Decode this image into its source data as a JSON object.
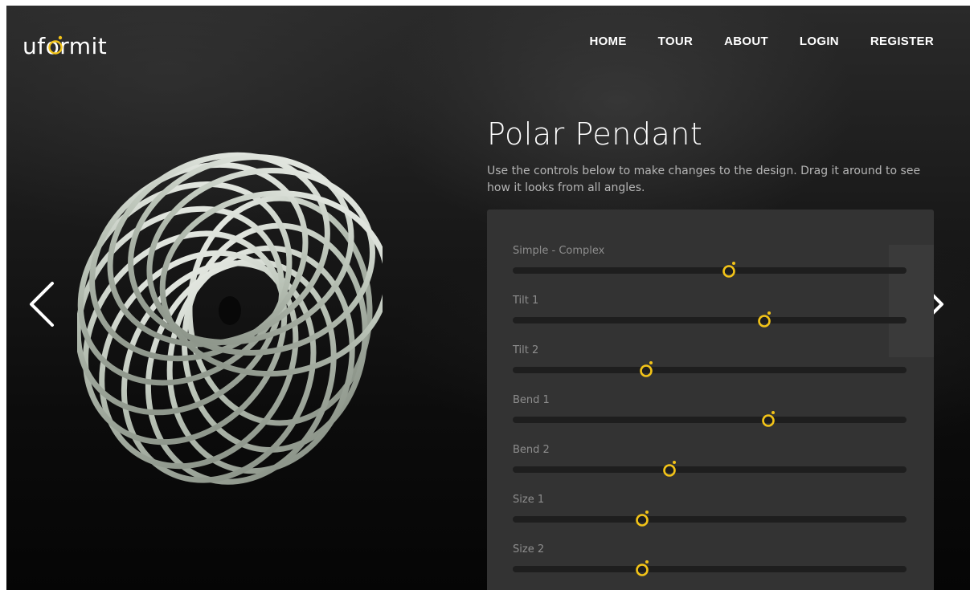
{
  "brand": {
    "logo_text": "uformit",
    "accent": "#f2c318"
  },
  "nav": {
    "items": [
      {
        "label": "HOME"
      },
      {
        "label": "TOUR"
      },
      {
        "label": "ABOUT"
      },
      {
        "label": "LOGIN"
      },
      {
        "label": "REGISTER"
      }
    ]
  },
  "product": {
    "title": "Polar Pendant",
    "description": "Use the controls below to make changes to the design. Drag it around to see how it looks from all angles."
  },
  "carousel": {
    "prev_icon": "chevron-left-icon",
    "next_icon": "chevron-right-icon"
  },
  "sliders": [
    {
      "label": "Simple - Complex",
      "value": 0.55
    },
    {
      "label": "Tilt 1",
      "value": 0.64
    },
    {
      "label": "Tilt 2",
      "value": 0.34
    },
    {
      "label": "Bend 1",
      "value": 0.65
    },
    {
      "label": "Bend 2",
      "value": 0.4
    },
    {
      "label": "Size 1",
      "value": 0.33
    },
    {
      "label": "Size 2",
      "value": 0.33
    }
  ]
}
